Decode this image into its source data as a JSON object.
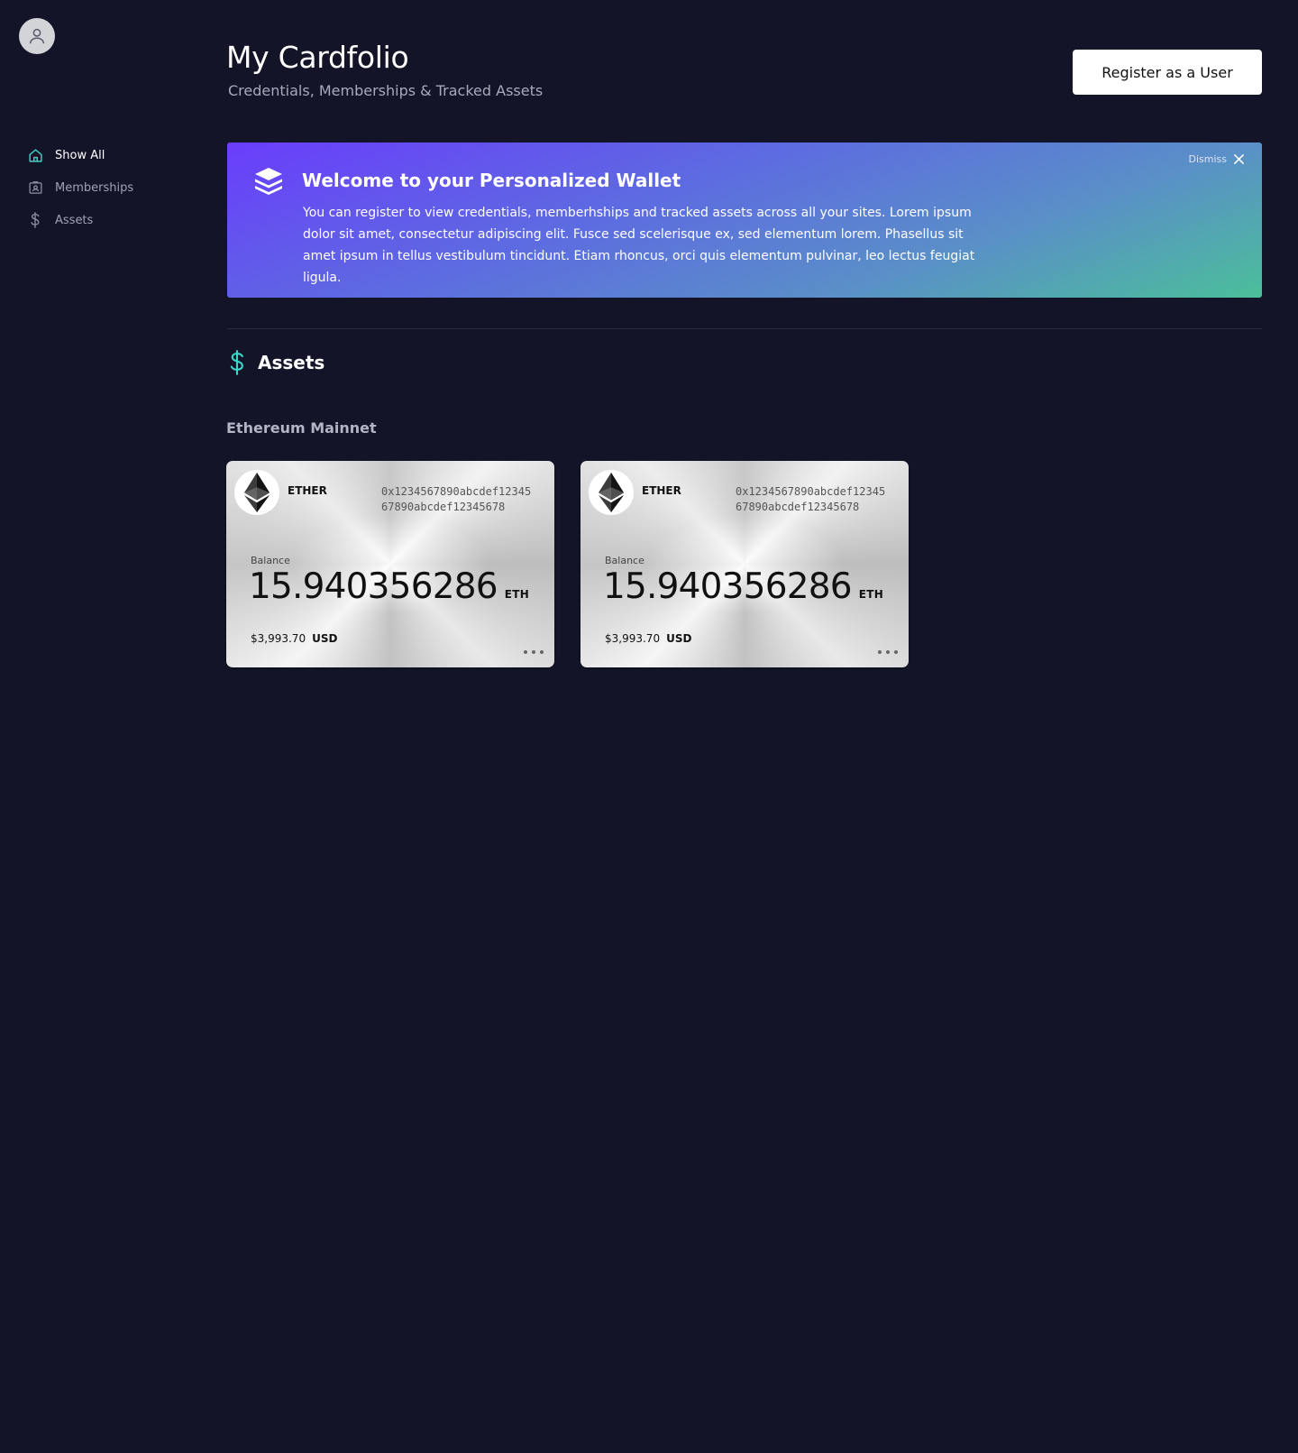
{
  "header": {
    "title": "My Cardfolio",
    "subtitle": "Credentials, Memberships & Tracked Assets",
    "register_label": "Register as a User"
  },
  "sidebar": {
    "items": [
      {
        "label": "Show All",
        "icon": "home-icon",
        "active": true
      },
      {
        "label": "Memberships",
        "icon": "id-card-icon",
        "active": false
      },
      {
        "label": "Assets",
        "icon": "dollar-icon",
        "active": false
      }
    ]
  },
  "banner": {
    "title": "Welcome to your Personalized Wallet",
    "text": "You can register to view credentials, memberhships and tracked assets across all your sites.  Lorem ipsum dolor sit amet, consectetur adipiscing elit. Fusce sed scelerisque ex, sed elementum lorem. Phasellus sit amet ipsum in tellus vestibulum tincidunt. Etiam rhoncus, orci quis elementum pulvinar, leo lectus feugiat ligula.",
    "dismiss_label": "Dismiss"
  },
  "assets": {
    "section_title": "Assets",
    "network": "Ethereum Mainnet",
    "cards": [
      {
        "token": "ETHER",
        "address": "0x1234567890abcdef1234567890abcdef12345678",
        "balance_label": "Balance",
        "balance": "15.940356286",
        "balance_unit": "ETH",
        "usd_value": "$3,993.70",
        "usd_unit": "USD"
      },
      {
        "token": "ETHER",
        "address": "0x1234567890abcdef1234567890abcdef12345678",
        "balance_label": "Balance",
        "balance": "15.940356286",
        "balance_unit": "ETH",
        "usd_value": "$3,993.70",
        "usd_unit": "USD"
      }
    ]
  },
  "colors": {
    "background": "#131428",
    "accent": "#3dd6c8",
    "banner_start": "#6a3dfc",
    "banner_end": "#4bbf9a"
  }
}
